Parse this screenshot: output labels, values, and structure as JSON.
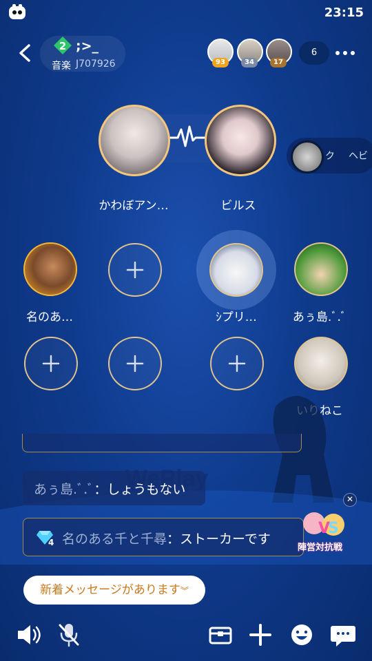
{
  "status": {
    "time": "23:15"
  },
  "header": {
    "room_name": ";>_",
    "level": "2",
    "category": "音楽",
    "room_id": "J707926",
    "audience": [
      {
        "badge": "93",
        "color": "#f0a51e"
      },
      {
        "badge": "34",
        "color": "#7c8aa6"
      },
      {
        "badge": "17",
        "color": "#a7742f"
      }
    ],
    "online_count": "6"
  },
  "hosts": [
    {
      "name": "かわぼアン…"
    },
    {
      "name": "ビルス"
    }
  ],
  "side_panel": {
    "text_a": "ク",
    "text_b": "ヘビ"
  },
  "seats_row1": [
    {
      "name": "名のあ…"
    },
    {
      "name": ""
    },
    {
      "name": "ｼプリ…"
    },
    {
      "name": "あぅ島.ﾞ.ﾞ"
    }
  ],
  "seats_row2": [
    {
      "name": ""
    },
    {
      "name": ""
    },
    {
      "name": ""
    },
    {
      "name": "いりねこ"
    }
  ],
  "chat": [
    {
      "user": "あぅ島.ﾞ.ﾞ",
      "message": "しょうもない"
    },
    {
      "level": "4",
      "user": "名のある千と千尋",
      "message": "ストーカーです"
    }
  ],
  "new_message_label": "新着メッセージがあります",
  "event_badge": "陣営対抗戦",
  "watermark": "WePlay",
  "colors": {
    "accent": "#f2c77b",
    "bg": "#0f3b8d",
    "new_msg_text": "#c87a1e"
  }
}
